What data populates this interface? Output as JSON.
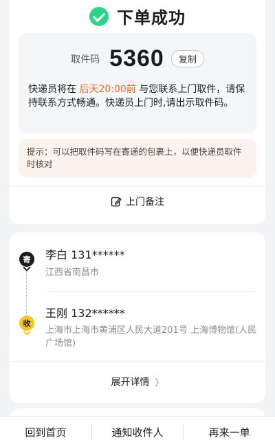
{
  "header": {
    "success_text": "下单成功"
  },
  "pickup": {
    "label": "取件码",
    "code": "5360",
    "copy_label": "复制",
    "desc_prefix": "快递员将在 ",
    "desc_highlight": "后天20:00前",
    "desc_suffix": " 与您联系上门取件，请保持联系方式畅通。快递员上门时,请出示取件码。",
    "tip": "提示：可以把取件码写在寄递的包裹上，以便快递员取件时核对"
  },
  "remark": {
    "label": "上门备注"
  },
  "sender": {
    "badge": "寄",
    "name": "李白 131******",
    "address": "江西省南昌市"
  },
  "receiver": {
    "badge": "收",
    "name": "王刚 132******",
    "address": "上海市上海市黄浦区人民大道201号 上海博物馆(人民广场馆)"
  },
  "details": {
    "label": "展开详情",
    "chevron": "〉"
  },
  "bottom": {
    "home": "回到首页",
    "notify": "通知收件人",
    "again": "再来一单"
  },
  "colors": {
    "success": "#2fd487",
    "highlight": "#f5632a",
    "receiver_badge": "#f7c325"
  },
  "icons": {
    "success": "check-circle-icon",
    "remark": "edit-note-icon",
    "details": "chevron-right-icon"
  }
}
